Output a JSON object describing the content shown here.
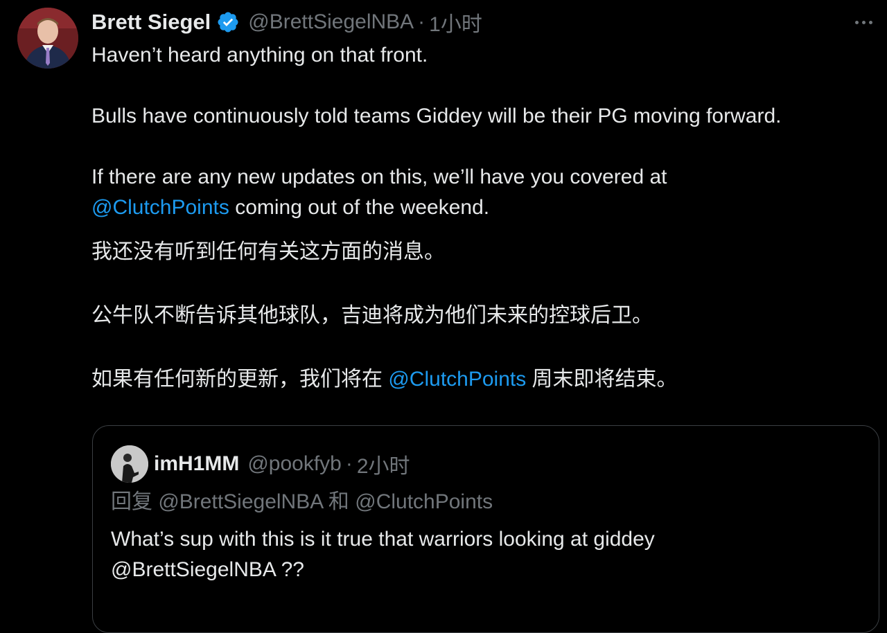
{
  "tweet": {
    "author_name": "Brett Siegel",
    "author_handle": "@BrettSiegelNBA",
    "separator": "·",
    "time": "1小时",
    "verified_color": "#1d9bf0",
    "line1": "Haven’t heard anything on that front.",
    "line2": "Bulls have continuously told teams Giddey will be their PG moving forward.",
    "line3": "If there are any new updates on this, we’ll have you covered at",
    "line4_mention": "@ClutchPoints",
    "line4_rest": " coming out of the weekend.",
    "zh_line1": "我还没有听到任何有关这方面的消息。",
    "zh_line2": "公牛队不断告诉其他球队，吉迪将成为他们未来的控球后卫。",
    "zh_line3_pre": "如果有任何新的更新，我们将在 ",
    "zh_line3_mention": "@ClutchPoints",
    "zh_line3_post": " 周末即将结束。"
  },
  "quote": {
    "author_name": "imH1MM",
    "author_handle": "@pookfyb",
    "separator": "·",
    "time": "2小时",
    "reply_prefix": "回复 ",
    "reply_mention1": "@BrettSiegelNBA",
    "reply_and": " 和 ",
    "reply_mention2": "@ClutchPoints",
    "text_line1": "What’s sup with this is it true that warriors looking at giddey",
    "text_line2": "@BrettSiegelNBA  ??"
  },
  "icons": {
    "more": "more-horizontal-icon",
    "verified": "verified-badge-icon"
  }
}
